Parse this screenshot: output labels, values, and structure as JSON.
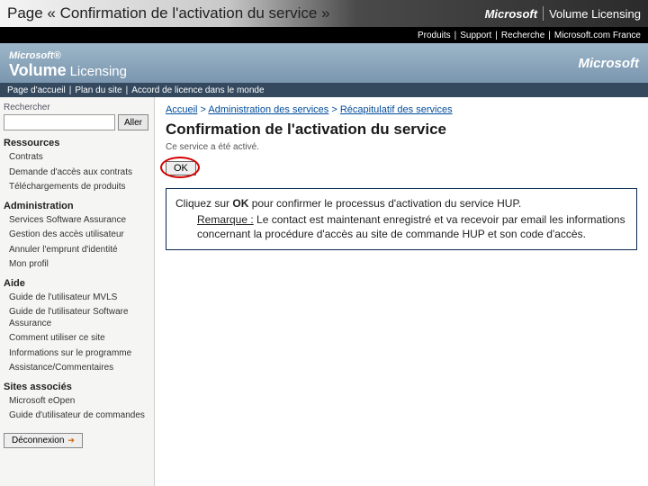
{
  "slide": {
    "title": "Page « Confirmation de l'activation du service »",
    "logo_brand": "Microsoft",
    "logo_product": "Volume Licensing"
  },
  "topbar1": {
    "items": [
      "Produits",
      "Support",
      "Recherche",
      "Microsoft.com France"
    ]
  },
  "brand": {
    "ms": "Microsoft®",
    "volume": "Volume",
    "licensing": "Licensing",
    "mslogo": "Microsoft"
  },
  "topbar2": {
    "items": [
      "Page d'accueil",
      "Plan du site",
      "Accord de licence dans le monde"
    ]
  },
  "sidebar": {
    "search_label": "Rechercher",
    "go_label": "Aller",
    "sections": [
      {
        "title": "Ressources",
        "items": [
          "Contrats",
          "Demande d'accès aux contrats",
          "Téléchargements de produits"
        ]
      },
      {
        "title": "Administration",
        "items": [
          "Services Software Assurance",
          "Gestion des accès utilisateur",
          "Annuler l'emprunt d'identité",
          "Mon profil"
        ]
      },
      {
        "title": "Aide",
        "items": [
          "Guide de l'utilisateur MVLS",
          "Guide de l'utilisateur Software Assurance",
          "Comment utiliser ce site",
          "Informations sur le programme",
          "Assistance/Commentaires"
        ]
      },
      {
        "title": "Sites associés",
        "items": [
          "Microsoft eOpen",
          "Guide d'utilisateur de commandes"
        ]
      }
    ],
    "logout": "Déconnexion"
  },
  "main": {
    "breadcrumb": {
      "a": "Accueil",
      "b": "Administration des services",
      "c": "Récapitulatif des services"
    },
    "heading": "Confirmation de l'activation du service",
    "subtext": "Ce service a été activé.",
    "ok_label": "OK",
    "callout": {
      "prefix": "Cliquez sur ",
      "ok": "OK",
      "suffix": " pour confirmer le processus d'activation du service HUP.",
      "remark_label": "Remarque :",
      "remark_text": " Le contact est maintenant enregistré et va recevoir par email les informations concernant la procédure d'accès au site de commande HUP et son code d'accès."
    }
  }
}
